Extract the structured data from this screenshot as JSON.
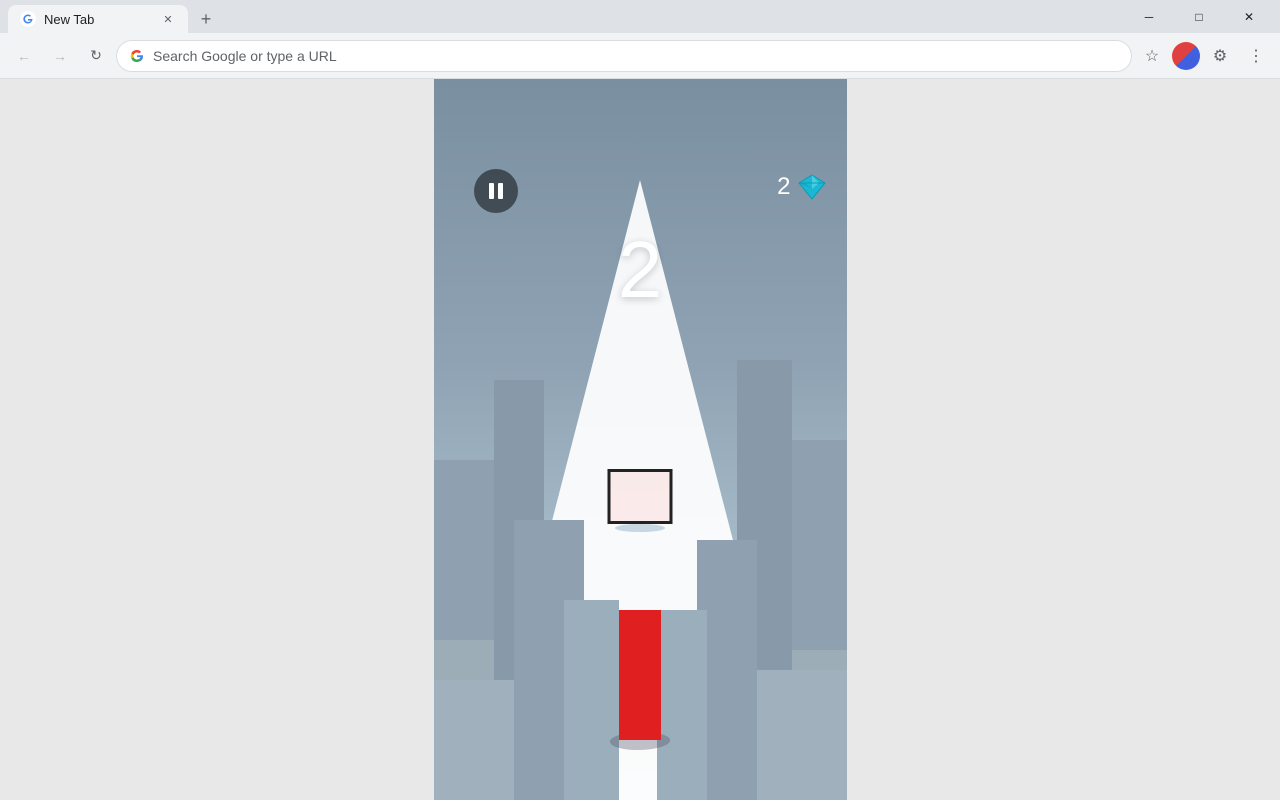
{
  "browser": {
    "tab": {
      "title": "New Tab",
      "favicon": "G"
    },
    "new_tab_btn": "+",
    "address_bar": {
      "placeholder": "Search Google or type a URL",
      "value": "Search Google or type a URL"
    },
    "window_controls": {
      "minimize": "─",
      "maximize": "□",
      "close": "✕"
    }
  },
  "game": {
    "score": "2",
    "gem_count": "2",
    "pause_label": "pause",
    "gem_label": "gem"
  }
}
